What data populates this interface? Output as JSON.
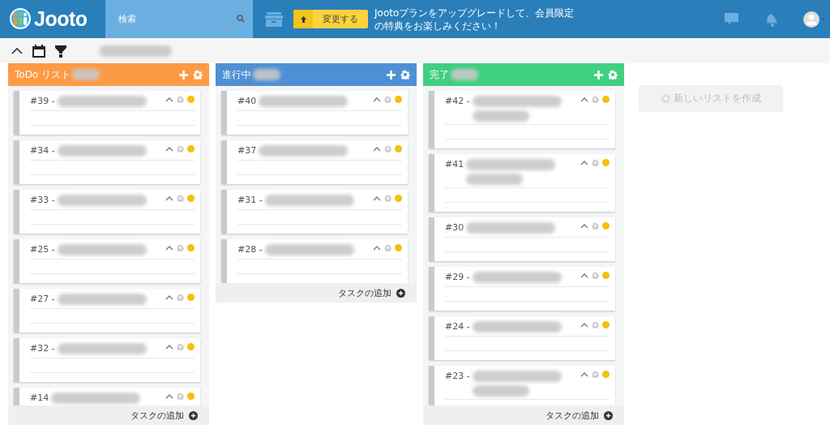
{
  "header": {
    "logo": "Jooto",
    "search": {
      "placeholder": "検索"
    },
    "upgrade_button": "変更する",
    "promo": [
      "Jootoプランをアップグレードして、会員限定",
      "の特典をお楽しみください！"
    ]
  },
  "columns": [
    {
      "title": "ToDo リスト",
      "color": "#fd9a45",
      "add_label": "タスクの追加",
      "tasks": [
        {
          "title": "#39 -",
          "kind": "single"
        },
        {
          "title": "#34 -",
          "kind": "single"
        },
        {
          "title": "#33 -",
          "kind": "single"
        },
        {
          "title": "#25 -",
          "kind": "single"
        },
        {
          "title": "#27 -",
          "kind": "single"
        },
        {
          "title": "#32 -",
          "kind": "single"
        },
        {
          "title": "#14",
          "kind": "single"
        }
      ]
    },
    {
      "title": "進行中",
      "color": "#4f90d4",
      "add_label": "タスクの追加",
      "tasks": [
        {
          "title": "#40",
          "kind": "single"
        },
        {
          "title": "#37",
          "kind": "single"
        },
        {
          "title": "#31 -",
          "kind": "single"
        },
        {
          "title": "#28 -",
          "kind": "single"
        }
      ]
    },
    {
      "title": "完了",
      "color": "#40cf80",
      "add_label": "タスクの追加",
      "tasks": [
        {
          "title": "#42 -",
          "kind": "double"
        },
        {
          "title": "#41",
          "kind": "double"
        },
        {
          "title": "#30",
          "kind": "single"
        },
        {
          "title": "#29 -",
          "kind": "single"
        },
        {
          "title": "#24 -",
          "kind": "single"
        },
        {
          "title": "#23 -",
          "kind": "double"
        }
      ]
    }
  ],
  "new_list": "新しいリストを作成"
}
